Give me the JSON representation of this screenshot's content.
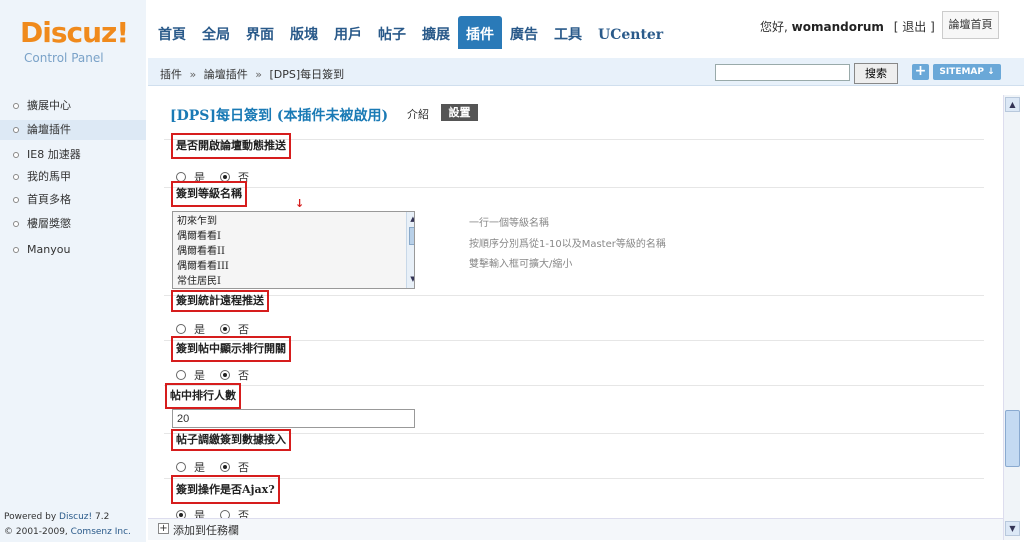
{
  "brand": {
    "logo_main": "Discuz!",
    "logo_sub": "Control Panel"
  },
  "nav": {
    "tabs": [
      {
        "label": "首頁"
      },
      {
        "label": "全局"
      },
      {
        "label": "界面"
      },
      {
        "label": "版塊"
      },
      {
        "label": "用戶"
      },
      {
        "label": "帖子"
      },
      {
        "label": "擴展"
      },
      {
        "label": "插件"
      },
      {
        "label": "廣告"
      },
      {
        "label": "工具"
      },
      {
        "label": "UCenter"
      }
    ],
    "active_index": 7
  },
  "user": {
    "greeting": "您好,",
    "username": "womandorum",
    "logout_label": "[ 退出 ]",
    "home_button": "論壇首頁"
  },
  "breadcrumb": {
    "items": [
      "插件",
      "論壇插件",
      "[DPS]每日簽到"
    ],
    "separator": "»"
  },
  "search": {
    "button_label": "搜索",
    "value": ""
  },
  "toolbar": {
    "plus_label": "+",
    "sitemap_label": "SITEMAP ↓"
  },
  "sidebar": {
    "items": [
      {
        "label": "擴展中心",
        "active": false
      },
      {
        "label": "論壇插件",
        "active": true
      },
      {
        "label": "IE8 加速器",
        "active": false
      },
      {
        "label": "我的馬甲",
        "active": false
      },
      {
        "label": "首頁多格",
        "active": false
      },
      {
        "label": "樓層獎懲",
        "active": false
      },
      {
        "label": "Manyou",
        "active": false
      }
    ],
    "powered_line1_prefix": "Powered by ",
    "powered_line1_link": "Discuz!",
    "powered_line1_version": " 7.2",
    "powered_line2_prefix": "© 2001-2009, ",
    "powered_line2_link": "Comsenz Inc."
  },
  "plugin": {
    "title": "[DPS]每日簽到 (本插件未被啟用)",
    "tab_intro": "介紹",
    "tab_settings": "設置"
  },
  "settings": {
    "field1": {
      "title": "是否開啟論壇動態推送",
      "yes": "是",
      "no": "否",
      "selected": "no"
    },
    "field2": {
      "title": "簽到等級名稱",
      "levels": [
        "初來乍到",
        "偶爾看看I",
        "偶爾看看II",
        "偶爾看看III",
        "常住居民I"
      ],
      "hints": [
        "一行一個等級名稱",
        "按順序分別爲從1-10以及Master等級的名稱",
        "雙擊輸入框可擴大/縮小"
      ]
    },
    "field3": {
      "title": "簽到統計遠程推送",
      "yes": "是",
      "no": "否",
      "selected": "no"
    },
    "field4": {
      "title": "簽到帖中顯示排行開關",
      "yes": "是",
      "no": "否",
      "selected": "no"
    },
    "field5": {
      "title": "帖中排行人數",
      "value": "20"
    },
    "field6": {
      "title": "帖子調繳簽到數據接入",
      "yes": "是",
      "no": "否",
      "selected": "no"
    },
    "field7": {
      "title": "簽到操作是否Ajax?",
      "yes": "是",
      "no": "否",
      "selected": "yes"
    }
  },
  "footer": {
    "plus": "+",
    "label": "添加到任務欄"
  },
  "colors": {
    "accent": "#2a7ab8",
    "highlight_box": "#d61d1d",
    "logo_orange": "#f08a1c",
    "sidebar_bg": "#eef4fa"
  },
  "icons": {
    "red_arrow": "↓",
    "scroll_up": "▲",
    "scroll_down": "▼"
  }
}
